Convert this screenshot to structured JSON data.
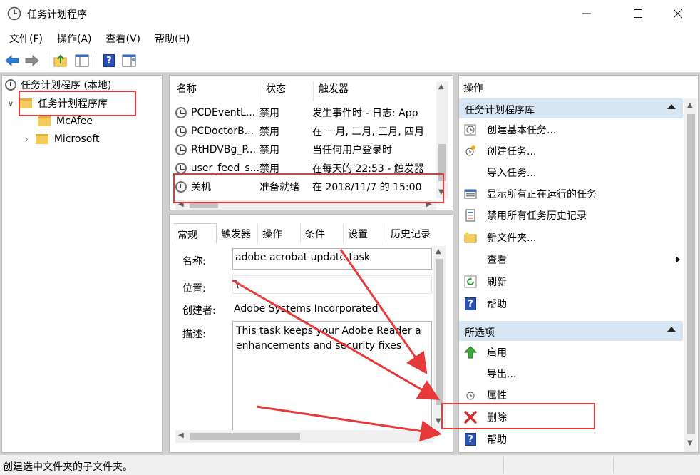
{
  "window": {
    "title": "任务计划程序",
    "minimize_icon": "minimize-icon",
    "maximize_icon": "maximize-icon",
    "close_icon": "close-icon"
  },
  "menubar": {
    "items": [
      "文件(F)",
      "操作(A)",
      "查看(V)",
      "帮助(H)"
    ]
  },
  "toolbar": {
    "buttons": [
      "back-arrow-icon",
      "forward-arrow-icon",
      "up-folder-icon",
      "show-hide-tree-icon",
      "help-icon",
      "show-hide-action-pane-icon"
    ]
  },
  "tree": {
    "root": "任务计划程序 (本地)",
    "library": "任务计划程序库",
    "children": [
      "McAfee",
      "Microsoft"
    ]
  },
  "task_list": {
    "columns": [
      "名称",
      "状态",
      "触发器"
    ],
    "rows": [
      {
        "name": "PCDEventL...",
        "status": "禁用",
        "trigger": "发生事件时 - 日志: App"
      },
      {
        "name": "PCDoctorB...",
        "status": "禁用",
        "trigger": "在 一月, 二月, 三月, 四月"
      },
      {
        "name": "RtHDVBg_P...",
        "status": "禁用",
        "trigger": "当任何用户登录时"
      },
      {
        "name": "user_feed_s...",
        "status": "禁用",
        "trigger": "在每天的 22:53 - 触发器"
      },
      {
        "name": "关机",
        "status": "准备就绪",
        "trigger": "在 2018/11/7 的 15:00"
      }
    ]
  },
  "details": {
    "tabs": [
      "常规",
      "触发器",
      "操作",
      "条件",
      "设置",
      "历史记录"
    ],
    "active_tab": "常规",
    "name_label": "名称:",
    "name_value": "adobe acrobat update task",
    "location_label": "位置:",
    "location_value": "\\",
    "author_label": "创建者:",
    "author_value": "Adobe Systems Incorporated",
    "description_label": "描述:",
    "description_value": "This task keeps your Adobe Reader a enhancements and security fixes"
  },
  "actions": {
    "header": "操作",
    "section1": {
      "title": "任务计划程序库",
      "items": [
        {
          "label": "创建基本任务...",
          "icon": "create-basic-task-icon"
        },
        {
          "label": "创建任务...",
          "icon": "create-task-icon"
        },
        {
          "label": "导入任务...",
          "icon": ""
        },
        {
          "label": "显示所有正在运行的任务",
          "icon": "running-tasks-icon"
        },
        {
          "label": "禁用所有任务历史记录",
          "icon": "history-icon"
        },
        {
          "label": "新文件夹...",
          "icon": "new-folder-icon"
        },
        {
          "label": "查看",
          "icon": ""
        },
        {
          "label": "刷新",
          "icon": "refresh-icon"
        },
        {
          "label": "帮助",
          "icon": "help-icon"
        }
      ]
    },
    "section2": {
      "title": "所选项",
      "items": [
        {
          "label": "启用",
          "icon": "enable-icon"
        },
        {
          "label": "导出...",
          "icon": ""
        },
        {
          "label": "属性",
          "icon": "properties-icon"
        },
        {
          "label": "删除",
          "icon": "delete-icon"
        },
        {
          "label": "帮助",
          "icon": "help-icon"
        }
      ]
    }
  },
  "statusbar": {
    "text": "创建选中文件夹的子文件夹。"
  },
  "colors": {
    "annotation_red": "#e8393a",
    "section_header": "#d8e6f4"
  }
}
